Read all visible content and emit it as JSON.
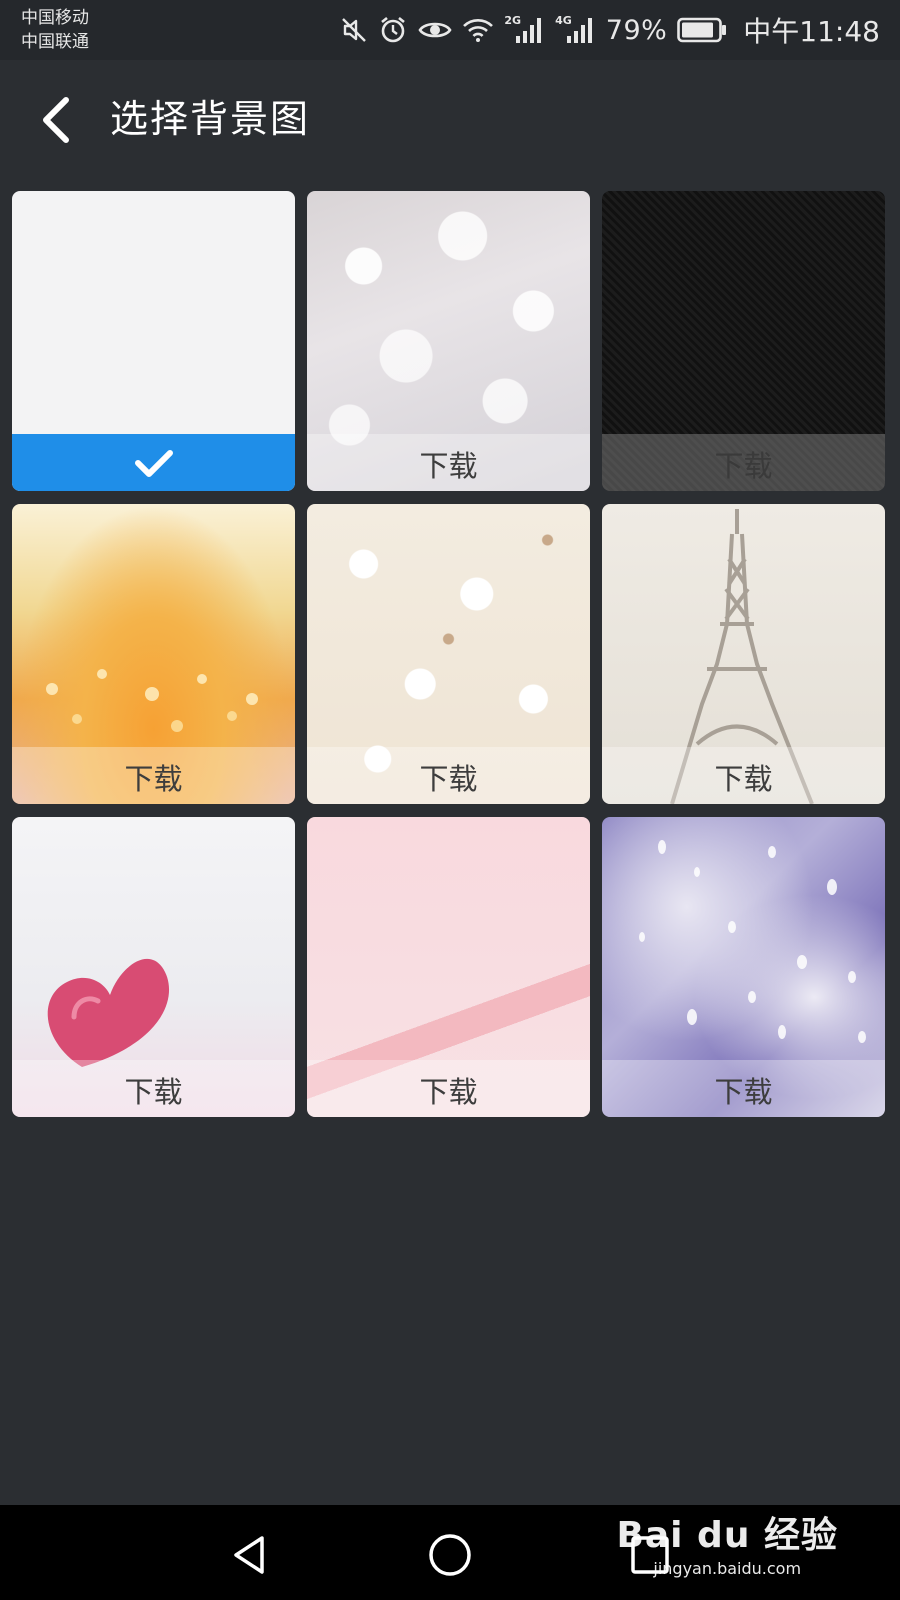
{
  "status_bar": {
    "carrier_1": "中国移动",
    "carrier_2": "中国联通",
    "net_badge_1": "2G",
    "net_badge_2": "4G",
    "battery_percent": "79%",
    "time": "中午11:48",
    "icons": [
      "mute-icon",
      "alarm-icon",
      "eye-icon",
      "wifi-icon",
      "signal-icon",
      "signal-icon",
      "battery-icon"
    ]
  },
  "header": {
    "title": "选择背景图",
    "back_icon": "chevron-left-icon"
  },
  "tiles": [
    {
      "label": "",
      "state": "selected",
      "icon": "checkmark-icon"
    },
    {
      "label": "下载",
      "state": "download"
    },
    {
      "label": "下载",
      "state": "download"
    },
    {
      "label": "下载",
      "state": "download"
    },
    {
      "label": "下载",
      "state": "download"
    },
    {
      "label": "下载",
      "state": "download"
    },
    {
      "label": "下载",
      "state": "download"
    },
    {
      "label": "下载",
      "state": "download"
    },
    {
      "label": "下载",
      "state": "download"
    }
  ],
  "colors": {
    "background": "#2b2e32",
    "selected_accent": "#1f8ee8"
  },
  "nav_bar": {
    "icons": [
      "back-triangle-icon",
      "home-circle-icon",
      "recents-square-icon"
    ]
  },
  "watermark": {
    "logo": "Bai du 经验",
    "url": "jingyan.baidu.com"
  }
}
